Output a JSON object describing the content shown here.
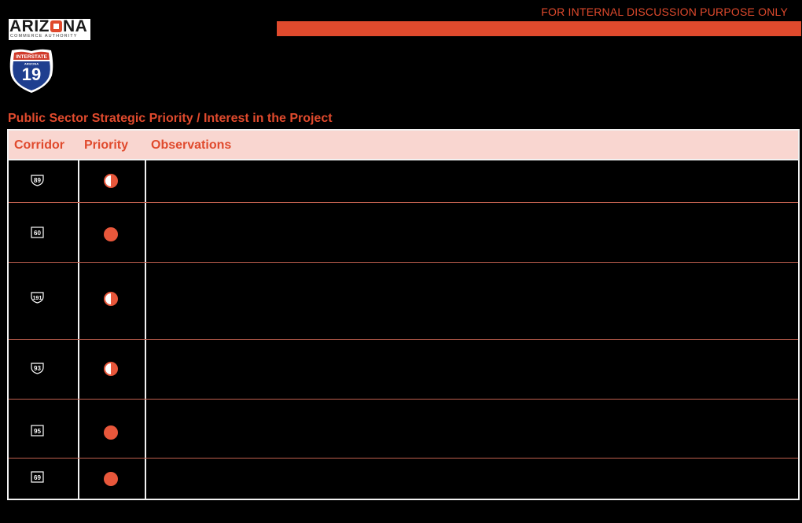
{
  "header": {
    "notice": "FOR INTERNAL DISCUSSION PURPOSE ONLY",
    "accent_color": "#e04a2d"
  },
  "logo": {
    "name_part1": "ARIZ",
    "name_part2": "NA",
    "subtitle": "COMMERCE AUTHORITY"
  },
  "interstate_shield": {
    "top_label": "INTERSTATE",
    "state_label": "ARIZONA",
    "number": "19"
  },
  "section": {
    "title": "Public Sector Strategic Priority / Interest in the Project"
  },
  "table": {
    "columns": [
      "Corridor",
      "Priority",
      "Observations"
    ],
    "rows": [
      {
        "route": "89",
        "route_type": "us-shield",
        "priority": "half",
        "observations": ""
      },
      {
        "route": "60",
        "route_type": "us-shield-boxed",
        "priority": "full",
        "observations": ""
      },
      {
        "route": "191",
        "route_type": "us-shield",
        "priority": "half",
        "observations": ""
      },
      {
        "route": "93",
        "route_type": "us-shield",
        "priority": "half",
        "observations": ""
      },
      {
        "route": "95",
        "route_type": "state-shield",
        "priority": "full",
        "observations": ""
      },
      {
        "route": "69",
        "route_type": "state-shield",
        "priority": "full",
        "observations": ""
      }
    ]
  }
}
